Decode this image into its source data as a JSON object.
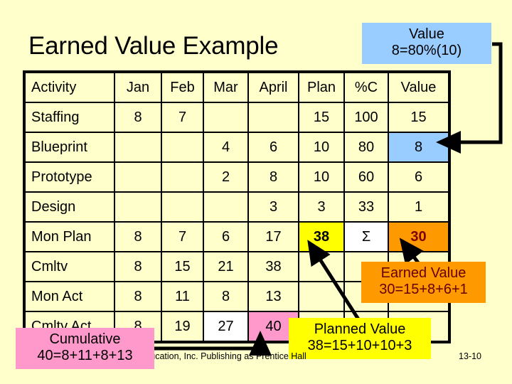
{
  "slide": {
    "title": "Earned Value Example",
    "background_color": "#FFFFCC",
    "page_number": "13-10",
    "copyright": "Copyright © 2010 Pearson Education, Inc. Publishing as Prentice Hall"
  },
  "table": {
    "columns": [
      "Activity",
      "Jan",
      "Feb",
      "Mar",
      "April",
      "Plan",
      "%C",
      "Value"
    ],
    "rows": [
      {
        "activity": "Staffing",
        "jan": "8",
        "feb": "7",
        "mar": "",
        "april": "",
        "plan": "15",
        "pc": "100",
        "value": "15"
      },
      {
        "activity": "Blueprint",
        "jan": "",
        "feb": "",
        "mar": "4",
        "april": "6",
        "plan": "10",
        "pc": "80",
        "value": "8"
      },
      {
        "activity": "Prototype",
        "jan": "",
        "feb": "",
        "mar": "2",
        "april": "8",
        "plan": "10",
        "pc": "60",
        "value": "6"
      },
      {
        "activity": "Design",
        "jan": "",
        "feb": "",
        "mar": "",
        "april": "3",
        "plan": "3",
        "pc": "33",
        "value": "1"
      },
      {
        "activity": "Mon Plan",
        "jan": "8",
        "feb": "7",
        "mar": "6",
        "april": "17",
        "plan": "38",
        "pc": "Σ",
        "value": "30"
      },
      {
        "activity": "Cmltv",
        "jan": "8",
        "feb": "15",
        "mar": "21",
        "april": "38",
        "plan": "",
        "pc": "",
        "value": ""
      },
      {
        "activity": "Mon Act",
        "jan": "8",
        "feb": "11",
        "mar": "8",
        "april": "13",
        "plan": "",
        "pc": "",
        "value": ""
      },
      {
        "activity": "Cmltv Act",
        "jan": "8",
        "feb": "19",
        "mar": "27",
        "april": "40",
        "plan": "",
        "pc": "",
        "value": ""
      }
    ]
  },
  "callouts": {
    "value": {
      "line1": "Value",
      "line2": "8=80%(10)",
      "color": "#99CCFF"
    },
    "earned_value": {
      "line1": "Earned Value",
      "line2": "30=15+8+6+1",
      "color": "#FF9900"
    },
    "planned_value": {
      "line1": "Planned Value",
      "line2": "38=15+10+10+3",
      "color": "#FFFF00"
    },
    "cumulative": {
      "line1": "Cumulative",
      "line2": "40=8+11+8+13",
      "color": "#FF99CC"
    }
  },
  "highlights": {
    "blue_cell": "8",
    "yellow_cell": "38",
    "white_sum_cell": "Σ",
    "orange_cell": "30",
    "white_cell": "27",
    "pink_cell": "40"
  }
}
